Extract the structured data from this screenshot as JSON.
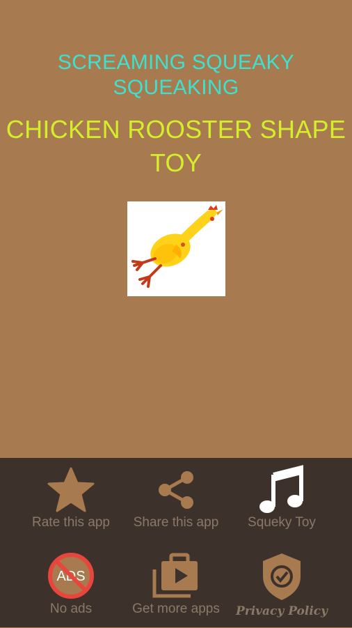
{
  "header": {
    "line1": "SCREAMING SQUEAKY SQUEAKING",
    "line2": "CHICKEN ROOSTER SHAPE TOY"
  },
  "image": {
    "icon": "rubber-chicken-image"
  },
  "bottom_bar": {
    "items": [
      {
        "label": "Rate this app",
        "icon": "star-icon"
      },
      {
        "label": "Share this app",
        "icon": "share-icon"
      },
      {
        "label": "Squeky Toy",
        "icon": "music-note-icon"
      },
      {
        "label": "No ads",
        "icon": "no-ads-icon"
      },
      {
        "label": "Get more apps",
        "icon": "apps-icon"
      },
      {
        "label": "Privacy Policy",
        "icon": "shield-check-icon"
      }
    ]
  },
  "colors": {
    "background": "#a87a4f",
    "bar": "#3d322b",
    "accent_cyan": "#3ee0d0",
    "accent_yellow": "#d4ee2a",
    "icon_brown": "#a87a4f"
  }
}
